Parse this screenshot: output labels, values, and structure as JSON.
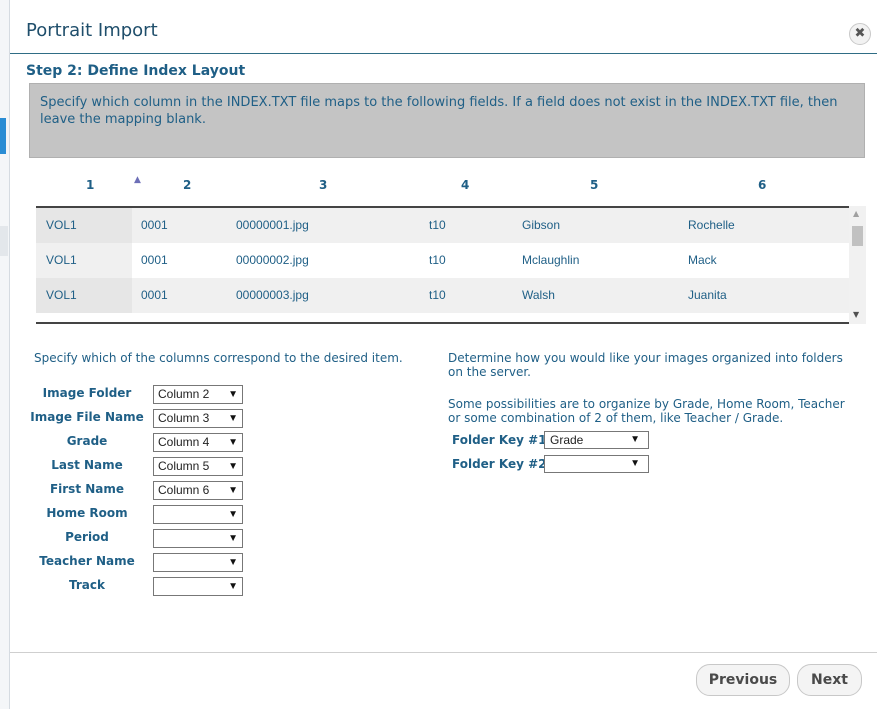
{
  "dialog": {
    "title": "Portrait Import",
    "close_icon": "close-icon",
    "step_heading": "Step 2: Define Index Layout",
    "instruction": "Specify which column in the INDEX.TXT file maps to the following fields. If a field does not exist in the INDEX.TXT file, then leave the mapping blank."
  },
  "grid": {
    "columns": [
      "1",
      "2",
      "3",
      "4",
      "5",
      "6"
    ],
    "sort_icon": "sort-ascending-icon",
    "rows": [
      [
        "VOL1",
        "0001",
        "00000001.jpg",
        "t10",
        "Gibson",
        "Rochelle"
      ],
      [
        "VOL1",
        "0001",
        "00000002.jpg",
        "t10",
        "Mclaughlin",
        "Mack"
      ],
      [
        "VOL1",
        "0001",
        "00000003.jpg",
        "t10",
        "Walsh",
        "Juanita"
      ]
    ]
  },
  "mapping": {
    "description": "Specify which of the columns correspond to the desired item.",
    "fields": [
      {
        "label": "Image Folder",
        "value": "Column 2"
      },
      {
        "label": "Image File Name",
        "value": "Column 3"
      },
      {
        "label": "Grade",
        "value": "Column 4"
      },
      {
        "label": "Last Name",
        "value": "Column 5"
      },
      {
        "label": "First Name",
        "value": "Column 6"
      },
      {
        "label": "Home Room",
        "value": ""
      },
      {
        "label": "Period",
        "value": ""
      },
      {
        "label": "Teacher Name",
        "value": ""
      },
      {
        "label": "Track",
        "value": ""
      }
    ]
  },
  "folders": {
    "description": "Determine how you would like your images organized into folders on the server.",
    "possibilities": "Some possibilities are to organize by Grade, Home Room, Teacher or some combination of 2 of them, like Teacher / Grade.",
    "keys": [
      {
        "label": "Folder Key #1",
        "value": "Grade"
      },
      {
        "label": "Folder Key #2",
        "value": ""
      }
    ]
  },
  "footer": {
    "previous_label": "Previous",
    "next_label": "Next"
  },
  "colors": {
    "accent_text": "#1f5f86",
    "instruction_bg": "#c4c4c4"
  }
}
